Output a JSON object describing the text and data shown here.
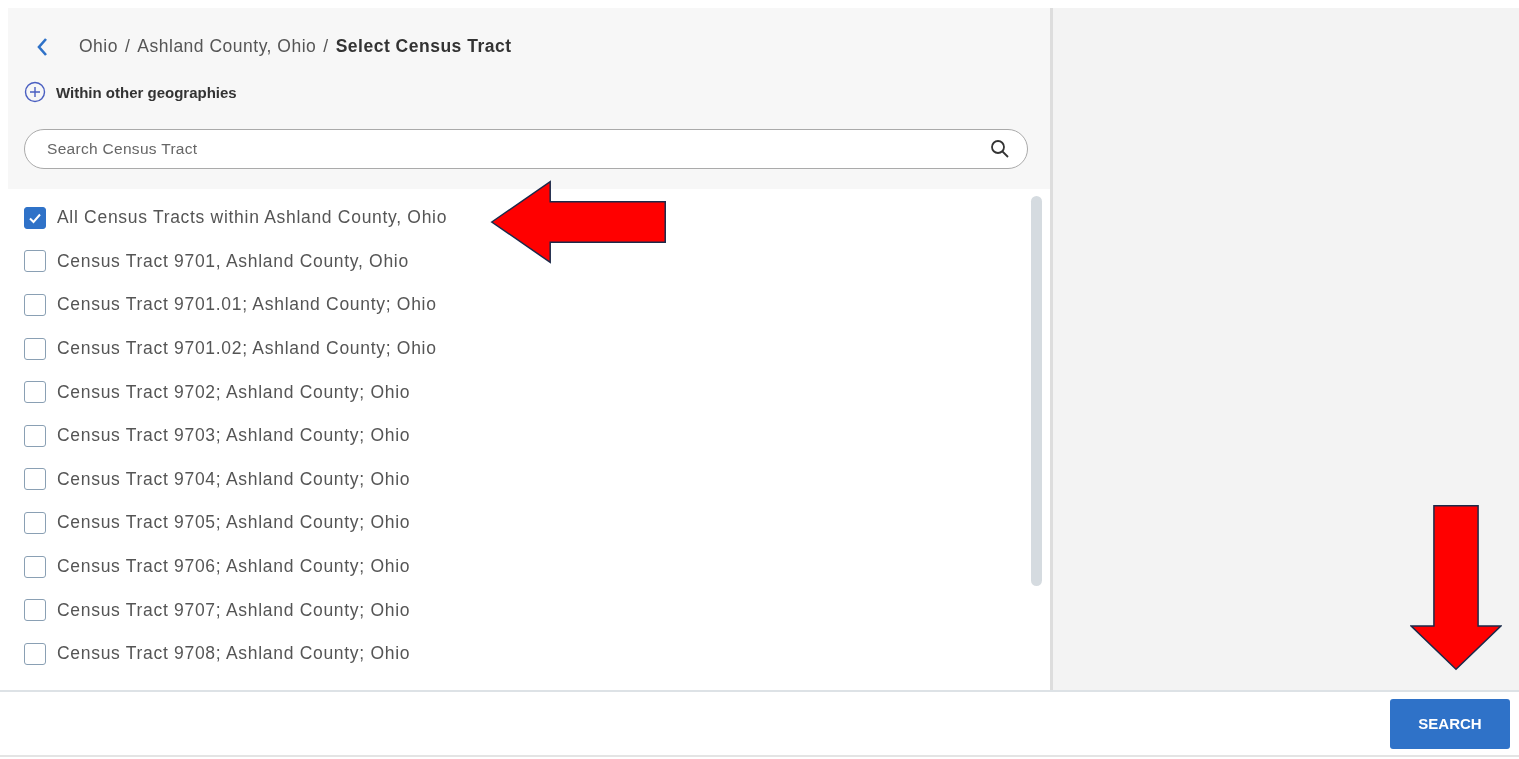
{
  "breadcrumb": {
    "items": [
      {
        "label": "Ohio",
        "separator": "/"
      },
      {
        "label": "Ashland County, Ohio",
        "separator": "/"
      }
    ],
    "current": "Select Census Tract"
  },
  "within_link": "Within other geographies",
  "search": {
    "placeholder": "Search Census Tract"
  },
  "tracts": [
    {
      "label": "All Census Tracts within Ashland County, Ohio",
      "checked": true
    },
    {
      "label": "Census Tract 9701, Ashland County, Ohio",
      "checked": false
    },
    {
      "label": "Census Tract 9701.01; Ashland County; Ohio",
      "checked": false
    },
    {
      "label": "Census Tract 9701.02; Ashland County; Ohio",
      "checked": false
    },
    {
      "label": "Census Tract 9702; Ashland County; Ohio",
      "checked": false
    },
    {
      "label": "Census Tract 9703; Ashland County; Ohio",
      "checked": false
    },
    {
      "label": "Census Tract 9704; Ashland County; Ohio",
      "checked": false
    },
    {
      "label": "Census Tract 9705; Ashland County; Ohio",
      "checked": false
    },
    {
      "label": "Census Tract 9706; Ashland County; Ohio",
      "checked": false
    },
    {
      "label": "Census Tract 9707; Ashland County; Ohio",
      "checked": false
    },
    {
      "label": "Census Tract 9708; Ashland County; Ohio",
      "checked": false
    }
  ],
  "search_button": "SEARCH"
}
